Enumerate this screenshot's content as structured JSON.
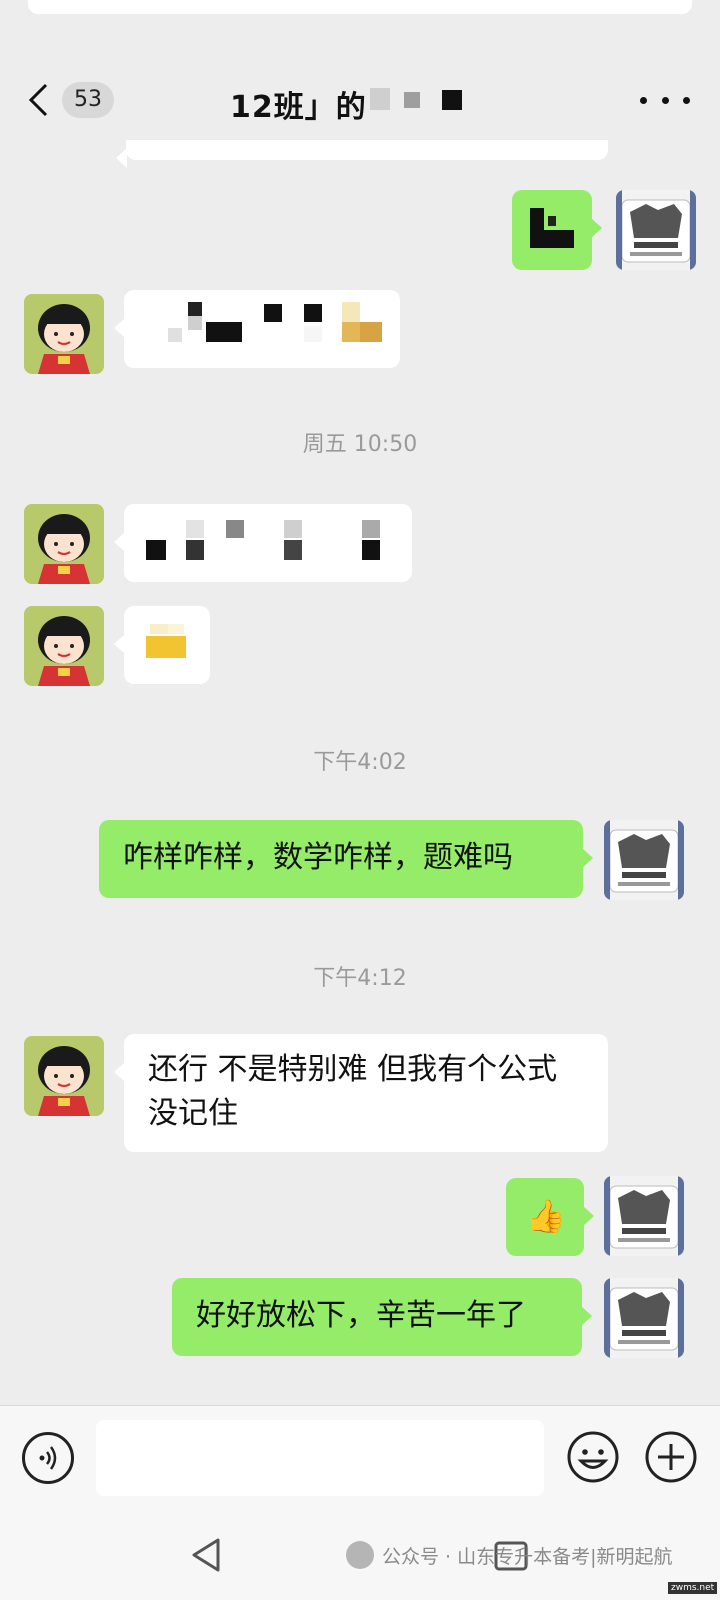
{
  "header": {
    "unread_count": "53",
    "title": "12班」的"
  },
  "messages": {
    "time_1": "周五 10:50",
    "time_2": "下午4:02",
    "time_3": "下午4:12",
    "m_self_1": "咋样咋样，数学咋样，题难吗",
    "m_peer_1_line1": "还行 不是特别难 但我有个公式",
    "m_peer_1_line2": "没记住",
    "m_self_thumb": "👍",
    "m_self_2": "好好放松下，辛苦一年了"
  },
  "self_avatar": {
    "caption": "撸起袖子加油干"
  },
  "navbar": {
    "watermark": "公众号 · 山东专升本备考|新明起航",
    "corner": "zwms.net"
  },
  "colors": {
    "chat_background": "#ededed",
    "self_bubble": "#95ec69",
    "peer_bubble": "#ffffff",
    "timestamp": "#9a9a9a"
  },
  "icons": [
    "chevron-left-icon",
    "more-dots-icon",
    "voice-icon",
    "emoji-icon",
    "plus-icon",
    "nav-back-icon",
    "nav-recent-icon"
  ]
}
